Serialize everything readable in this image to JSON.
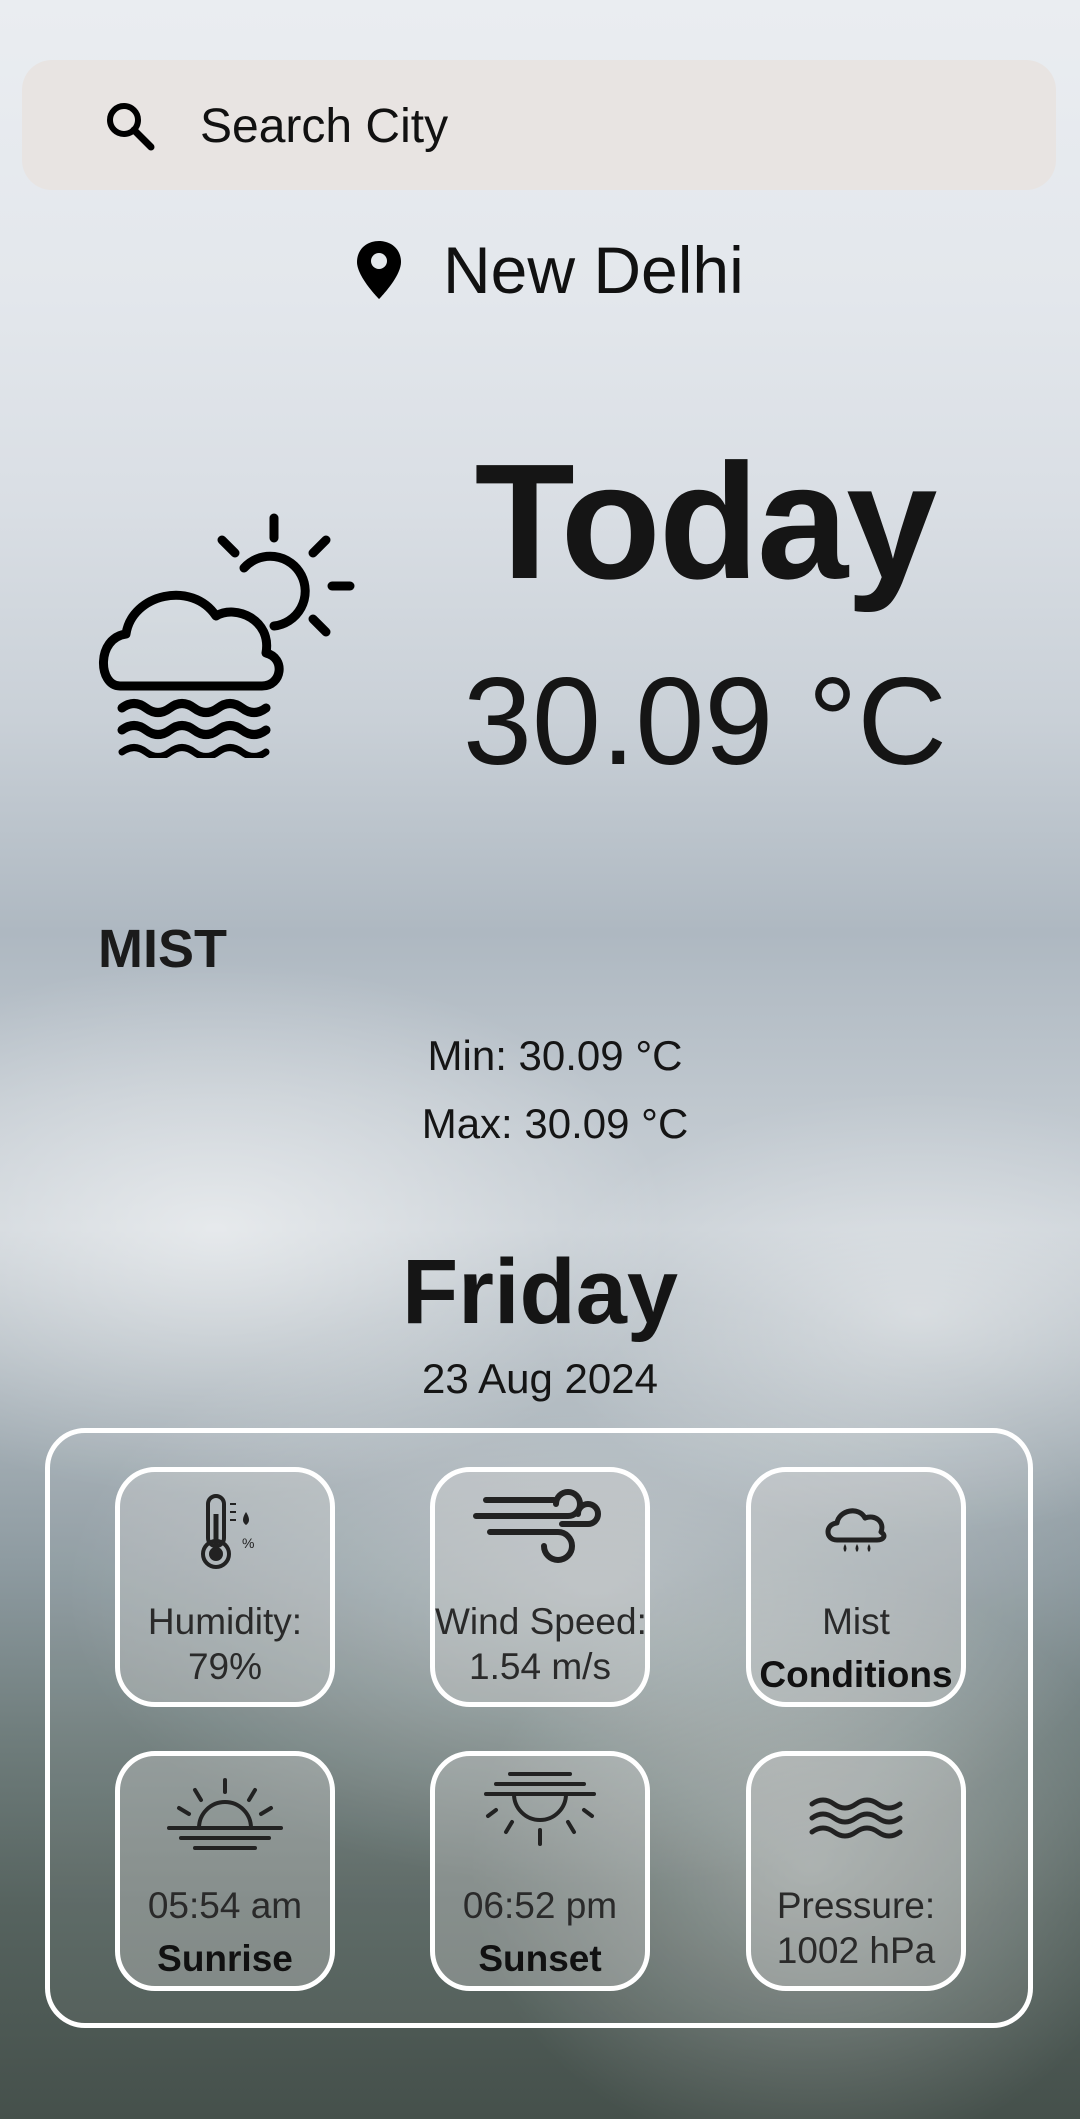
{
  "search": {
    "placeholder": "Search City",
    "icon": "search-icon"
  },
  "location": {
    "city": "New Delhi",
    "icon": "location-pin-icon"
  },
  "current": {
    "heading": "Today",
    "temperature": "30.09 °C",
    "condition": "MIST",
    "min": "Min: 30.09 °C",
    "max": "Max: 30.09 °C",
    "icon": "cloud-sun-mist-icon"
  },
  "date": {
    "day": "Friday",
    "full_date": "23 Aug 2024"
  },
  "details": {
    "humidity": {
      "label": "Humidity:",
      "value": "79%",
      "icon": "thermometer-humidity-icon"
    },
    "wind": {
      "label": "Wind Speed:",
      "value": "1.54 m/s",
      "icon": "wind-icon"
    },
    "conditions": {
      "value": "Mist",
      "label": "Conditions",
      "icon": "cloud-rain-icon"
    },
    "sunrise": {
      "value": "05:54 am",
      "label": "Sunrise",
      "icon": "sunrise-icon"
    },
    "sunset": {
      "value": "06:52 pm",
      "label": "Sunset",
      "icon": "sunset-icon"
    },
    "pressure": {
      "label": "Pressure:",
      "value": "1002 hPa",
      "icon": "waves-icon"
    }
  }
}
